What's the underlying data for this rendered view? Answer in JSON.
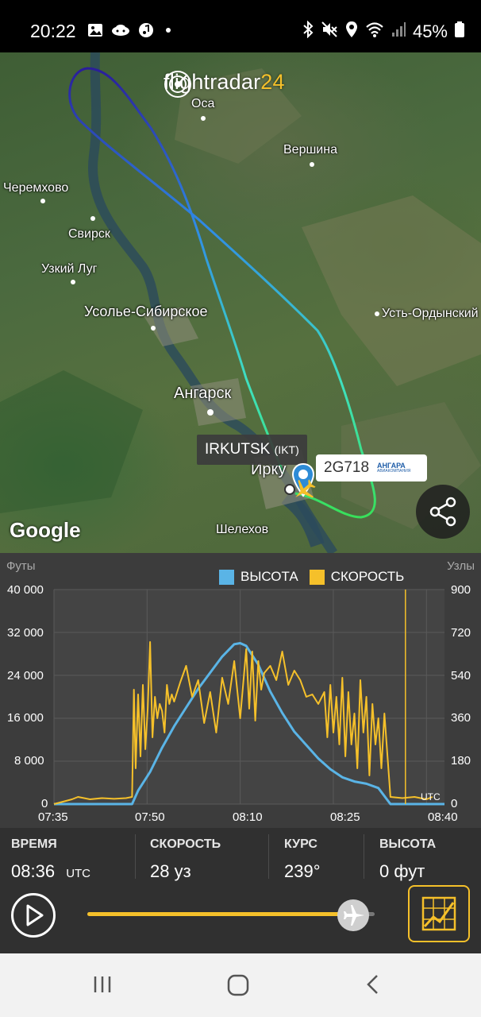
{
  "status_bar": {
    "time": "20:22",
    "battery_text": "45%",
    "left_icons": [
      "gallery-icon",
      "game-controller-icon",
      "music-icon",
      "dot-icon"
    ],
    "right_icons": [
      "bluetooth-icon",
      "mute-icon",
      "location-icon",
      "wifi-icon",
      "signal-icon",
      "battery-icon"
    ]
  },
  "map": {
    "logo_text_main": "flightradar",
    "logo_text_num": "24",
    "google_label": "Google",
    "cities": [
      {
        "id": "osa",
        "name": "Оса"
      },
      {
        "id": "vershina",
        "name": "Вершина"
      },
      {
        "id": "cheremkhovo",
        "name": "Черемхово"
      },
      {
        "id": "svirsk",
        "name": "Свирск"
      },
      {
        "id": "uzkiy-lug",
        "name": "Узкий Луг"
      },
      {
        "id": "usolye",
        "name": "Усолье-Сибирское"
      },
      {
        "id": "ust-ordynsky",
        "name": "Усть-Ордынский"
      },
      {
        "id": "angarsk",
        "name": "Ангарск"
      },
      {
        "id": "irkutsk",
        "name": "Ирку"
      },
      {
        "id": "shelekhov",
        "name": "Шелехов"
      }
    ],
    "airport_label": "IRKUTSK",
    "airport_code": "(IKT)",
    "flight_number": "2G718",
    "airline_name": "АНГАРА",
    "airline_sub": "АВИАКОМПАНИЯ"
  },
  "chart": {
    "left_axis_title": "Футы",
    "right_axis_title": "Узлы",
    "legend_altitude": "ВЫСОТА",
    "legend_speed": "СКОРОСТЬ",
    "utc_label": "UTC",
    "colors": {
      "altitude": "#5ab4e6",
      "speed": "#f5c02a",
      "grid": "#5a5a5a"
    }
  },
  "chart_data": {
    "type": "line",
    "xlabel": "",
    "ylabel": "Футы",
    "y2label": "Узлы",
    "x_ticks": [
      "07:35",
      "07:50",
      "08:10",
      "08:25",
      "08:40"
    ],
    "y_ticks": [
      "40 000",
      "32 000",
      "24 000",
      "16 000",
      "8 000",
      "0"
    ],
    "y2_ticks": [
      "900",
      "720",
      "540",
      "360",
      "180",
      "0"
    ],
    "xlim": [
      0,
      65
    ],
    "ylim": [
      0,
      40000
    ],
    "y2lim": [
      0,
      900
    ],
    "series": [
      {
        "name": "ВЫСОТА",
        "axis": "left",
        "x": [
          0,
          13,
          14,
          16,
          18,
          20,
          22,
          24,
          26,
          28,
          30,
          31,
          32,
          34,
          36,
          38,
          40,
          42,
          44,
          46,
          48,
          50,
          52,
          54,
          56,
          58,
          60,
          62,
          63,
          64,
          65
        ],
        "y": [
          0,
          0,
          2500,
          6000,
          10500,
          14500,
          18000,
          21500,
          24500,
          27500,
          29800,
          30000,
          29500,
          26000,
          21000,
          17000,
          13500,
          11000,
          8500,
          6500,
          5000,
          4200,
          3800,
          3000,
          0,
          0,
          0,
          0,
          0,
          0,
          0
        ]
      },
      {
        "name": "СКОРОСТЬ",
        "axis": "right",
        "x": [
          0,
          3,
          4,
          6,
          8,
          10,
          12,
          13,
          13.3,
          13.6,
          14,
          14.4,
          14.8,
          15.2,
          15.6,
          16,
          16.4,
          16.8,
          17.2,
          17.6,
          18,
          18.4,
          18.8,
          19.2,
          19.6,
          20,
          21,
          22,
          23,
          24,
          25,
          26,
          27,
          28,
          29,
          30,
          31,
          32,
          32.5,
          33,
          33.5,
          34,
          34.5,
          35,
          36,
          37,
          38,
          39,
          40,
          41,
          42,
          43,
          44,
          45,
          45.5,
          46,
          46.5,
          47,
          47.5,
          48,
          48.5,
          49,
          49.5,
          50,
          50.5,
          51,
          51.5,
          52,
          52.5,
          53,
          53.5,
          54,
          54.5,
          55,
          56,
          58,
          60,
          62,
          63
        ],
        "y": [
          0,
          20,
          30,
          20,
          25,
          22,
          25,
          30,
          480,
          150,
          460,
          200,
          500,
          230,
          400,
          680,
          280,
          450,
          360,
          420,
          390,
          300,
          500,
          420,
          460,
          430,
          510,
          580,
          450,
          520,
          340,
          470,
          300,
          530,
          420,
          600,
          360,
          650,
          400,
          640,
          350,
          600,
          480,
          550,
          580,
          520,
          640,
          500,
          560,
          520,
          450,
          460,
          420,
          470,
          280,
          500,
          300,
          450,
          250,
          530,
          200,
          470,
          250,
          380,
          150,
          520,
          300,
          450,
          120,
          420,
          250,
          360,
          150,
          380,
          30,
          25,
          30,
          20,
          30
        ]
      }
    ]
  },
  "info": {
    "time_label": "ВРЕМЯ",
    "time_value": "08:36",
    "time_unit": "UTC",
    "speed_label": "СКОРОСТЬ",
    "speed_value": "28 уз",
    "course_label": "КУРС",
    "course_value": "239°",
    "altitude_label": "ВЫСОТА",
    "altitude_value": "0 фут"
  },
  "playback": {
    "progress": 0.925
  }
}
